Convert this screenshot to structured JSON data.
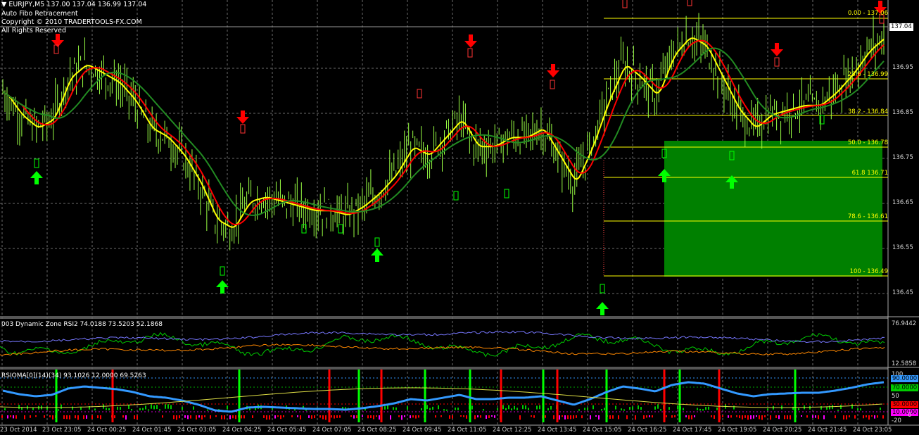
{
  "header": {
    "symbol_line": "EURJPY,M5  137.00 137.04 136.99 137.04",
    "indicator": "Auto Fibo Retracement",
    "copyright": "Copyright © 2010 TRADERTOOLS-FX.COM",
    "rights": "All Rights Reserved"
  },
  "price_axis": {
    "labels": [
      "136.95",
      "136.85",
      "136.75",
      "136.65",
      "136.55",
      "136.45"
    ],
    "current": "137.04"
  },
  "fibo_levels": [
    {
      "label": "0.00 - 137.06",
      "price": 137.06
    },
    {
      "label": "23.6 - 136.99",
      "price": 136.99
    },
    {
      "label": "38.2 - 136.84",
      "price": 136.84
    },
    {
      "label": "50.0 - 136.78",
      "price": 136.78
    },
    {
      "label": "61.8 136.71",
      "price": 136.71
    },
    {
      "label": "78.6 - 136.61",
      "price": 136.61
    },
    {
      "label": "100 - 136.49",
      "price": 136.49
    }
  ],
  "rsi_pane": {
    "title": "003 Dynamic Zone RSI2 74.0188 73.5203 52.1868",
    "scale_top": "76.9442",
    "scale_bottom": "12.5858"
  },
  "rsioma_pane": {
    "title": "RSIOMA[0](14)(34) 93.1026 12.0000 69.5263",
    "scale_labels": [
      "100",
      "90.0000",
      "70.0000",
      "50",
      "30.0000",
      "10.0000",
      "0",
      "-20"
    ],
    "box_colors": {
      "90": "#3399ff",
      "70": "#00cc00",
      "30": "#ff0000",
      "10": "#ff00ff"
    }
  },
  "time_axis": [
    "23 Oct 2014",
    "23 Oct 23:05",
    "24 Oct 00:25",
    "24 Oct 01:45",
    "24 Oct 03:05",
    "24 Oct 04:25",
    "24 Oct 05:45",
    "24 Oct 07:05",
    "24 Oct 08:25",
    "24 Oct 09:45",
    "24 Oct 11:05",
    "24 Oct 12:25",
    "24 Oct 13:45",
    "24 Oct 15:05",
    "24 Oct 16:25",
    "24 Oct 17:45",
    "24 Oct 19:05",
    "24 Oct 20:25",
    "24 Oct 21:45",
    "24 Oct 23:05"
  ],
  "colors": {
    "candles": "#99ff44",
    "ma_yellow": "#ffff00",
    "ma_red": "#ff0000",
    "ma_green": "#228b22",
    "fib_zone": "#008000",
    "arrow_up": "#00ff00",
    "arrow_down": "#ff0000",
    "grid": "#6b6b6b"
  },
  "chart_data": {
    "type": "line",
    "title": "EURJPY,M5",
    "ylim": [
      136.41,
      137.1
    ],
    "series": [
      {
        "values": [
          136.9,
          136.85,
          136.82,
          136.84,
          136.93,
          136.96,
          136.94,
          136.92,
          136.88,
          136.82,
          136.8,
          136.76,
          136.7,
          136.62,
          136.6,
          136.66,
          136.67,
          136.66,
          136.65,
          136.64,
          136.64,
          136.63,
          136.65,
          136.68,
          136.72,
          136.78,
          136.76,
          136.8,
          136.84,
          136.78,
          136.78,
          136.8,
          136.8,
          136.82,
          136.76,
          136.7,
          136.78,
          136.88,
          136.96,
          136.93,
          136.89,
          136.98,
          137.02,
          137.0,
          136.93,
          136.86,
          136.82,
          136.85,
          136.86,
          136.87,
          136.87,
          136.9,
          136.94,
          136.99,
          137.02
        ]
      }
    ]
  }
}
